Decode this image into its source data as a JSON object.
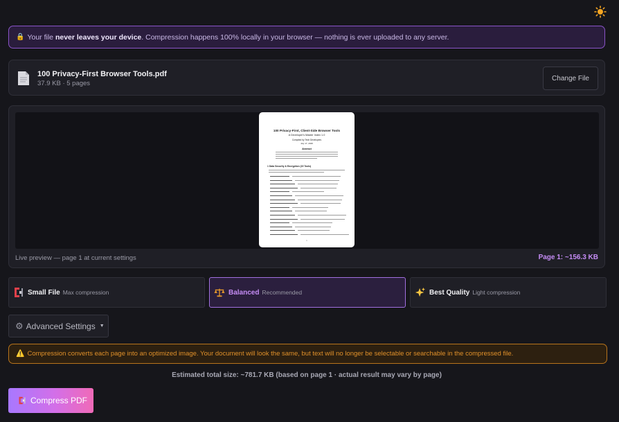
{
  "theme_toggle": {
    "icon": "sun-icon",
    "glyph": "☀️"
  },
  "privacy_banner": {
    "lock_glyph": "🔒",
    "text_before": "Your file ",
    "text_bold": "never leaves your device",
    "text_after": ". Compression happens 100% locally in your browser — nothing is ever uploaded to any server."
  },
  "file": {
    "name": "100 Privacy-First Browser Tools.pdf",
    "meta": "37.9 KB · 5 pages",
    "change_label": "Change File"
  },
  "preview": {
    "caption": "Live preview — page 1 at current settings",
    "page_size": "Page 1: ~156.3 KB",
    "thumbnail": {
      "title": "100 Privacy-First, Client-Side Browser Tools",
      "subtitle": "A Developer's Master Index 1.0",
      "author": "Compiled by Tech Developers",
      "date": "July 17, 2026",
      "abstract_heading": "Abstract",
      "section_heading": "1  Data Security & Encryption (15 Tools)"
    }
  },
  "presets": [
    {
      "id": "small",
      "icon": "clamp-icon",
      "glyph": "🗜",
      "title": "Small File",
      "subtitle": "Max compression",
      "active": false
    },
    {
      "id": "balanced",
      "icon": "scales-icon",
      "glyph": "⚖️",
      "title": "Balanced",
      "subtitle": "Recommended",
      "active": true
    },
    {
      "id": "quality",
      "icon": "sparkles-icon",
      "glyph": "✨",
      "title": "Best Quality",
      "subtitle": "Light compression",
      "active": false
    }
  ],
  "advanced": {
    "glyph": "⚙",
    "label": "Advanced Settings",
    "caret": "▼"
  },
  "warning": {
    "glyph": "⚠️",
    "text": "Compression converts each page into an optimized image. Your document will look the same, but text will no longer be selectable or searchable in the compressed file."
  },
  "estimate": "Estimated total size: ~781.7 KB (based on page 1 · actual result may vary by page)",
  "compress_button": {
    "glyph": "🗜",
    "label": "Compress PDF"
  },
  "colors": {
    "background": "#16161b",
    "accent": "#c58cf5",
    "privacy_border": "#8a54c8",
    "warning": "#e0902a",
    "compress_gradient_start": "#a878ff",
    "compress_gradient_end": "#f06ab7"
  }
}
